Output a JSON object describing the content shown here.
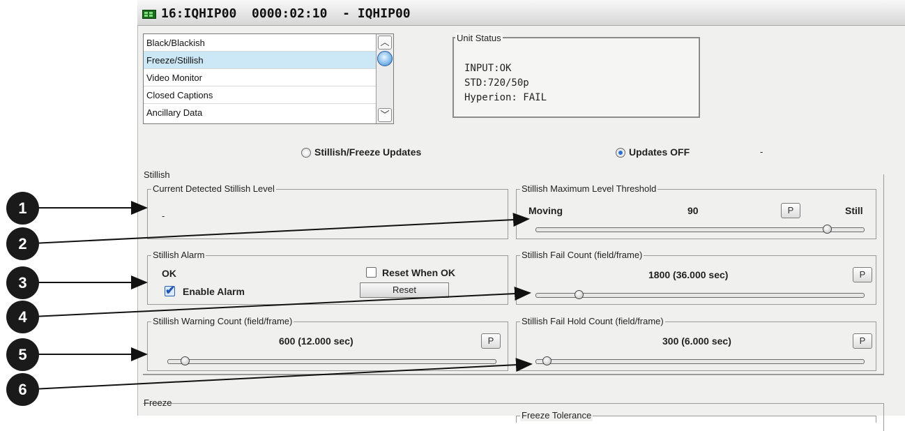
{
  "window": {
    "title": "16:IQHIP00  0000:02:10  - IQHIP00"
  },
  "list": {
    "items": [
      "Black/Blackish",
      "Freeze/Stillish",
      "Video Monitor",
      "Closed Captions",
      "Ancillary Data"
    ],
    "selected": "Freeze/Stillish"
  },
  "unit_status": {
    "legend": "Unit Status",
    "lines": [
      "INPUT:OK",
      "STD:720/50p",
      "Hyperion: FAIL"
    ]
  },
  "updates": {
    "option_1": "Stillish/Freeze Updates",
    "option_2": "Updates OFF",
    "selected": "Updates OFF",
    "status_value": "-"
  },
  "stillish": {
    "legend": "Stillish",
    "current_level": {
      "legend": "Current Detected Stillish Level",
      "value": "-"
    },
    "max_threshold": {
      "legend": "Stillish  Maximum Level Threshold",
      "left_label": "Moving",
      "value": "90",
      "right_label": "Still",
      "p_label": "P",
      "slider_fraction": 0.9
    },
    "alarm": {
      "legend": "Stillish Alarm",
      "status": "OK",
      "reset_when_ok_label": "Reset When OK",
      "reset_when_ok_checked": false,
      "enable_alarm_label": "Enable Alarm",
      "enable_alarm_checked": true,
      "reset_button": "Reset"
    },
    "fail_count": {
      "legend": "Stillish Fail Count (field/frame)",
      "value": "1800 (36.000 sec)",
      "p_label": "P",
      "slider_fraction": 0.12
    },
    "warning_count": {
      "legend": "Stillish Warning Count (field/frame)",
      "value": "600 (12.000 sec)",
      "p_label": "P",
      "slider_fraction": 0.04
    },
    "fail_hold_count": {
      "legend": "Stillish Fail Hold Count (field/frame)",
      "value": "300 (6.000 sec)",
      "p_label": "P",
      "slider_fraction": 0.02
    }
  },
  "freeze": {
    "legend": "Freeze",
    "tolerance_legend": "Freeze Tolerance"
  },
  "callouts": [
    "1",
    "2",
    "3",
    "4",
    "5",
    "6"
  ]
}
